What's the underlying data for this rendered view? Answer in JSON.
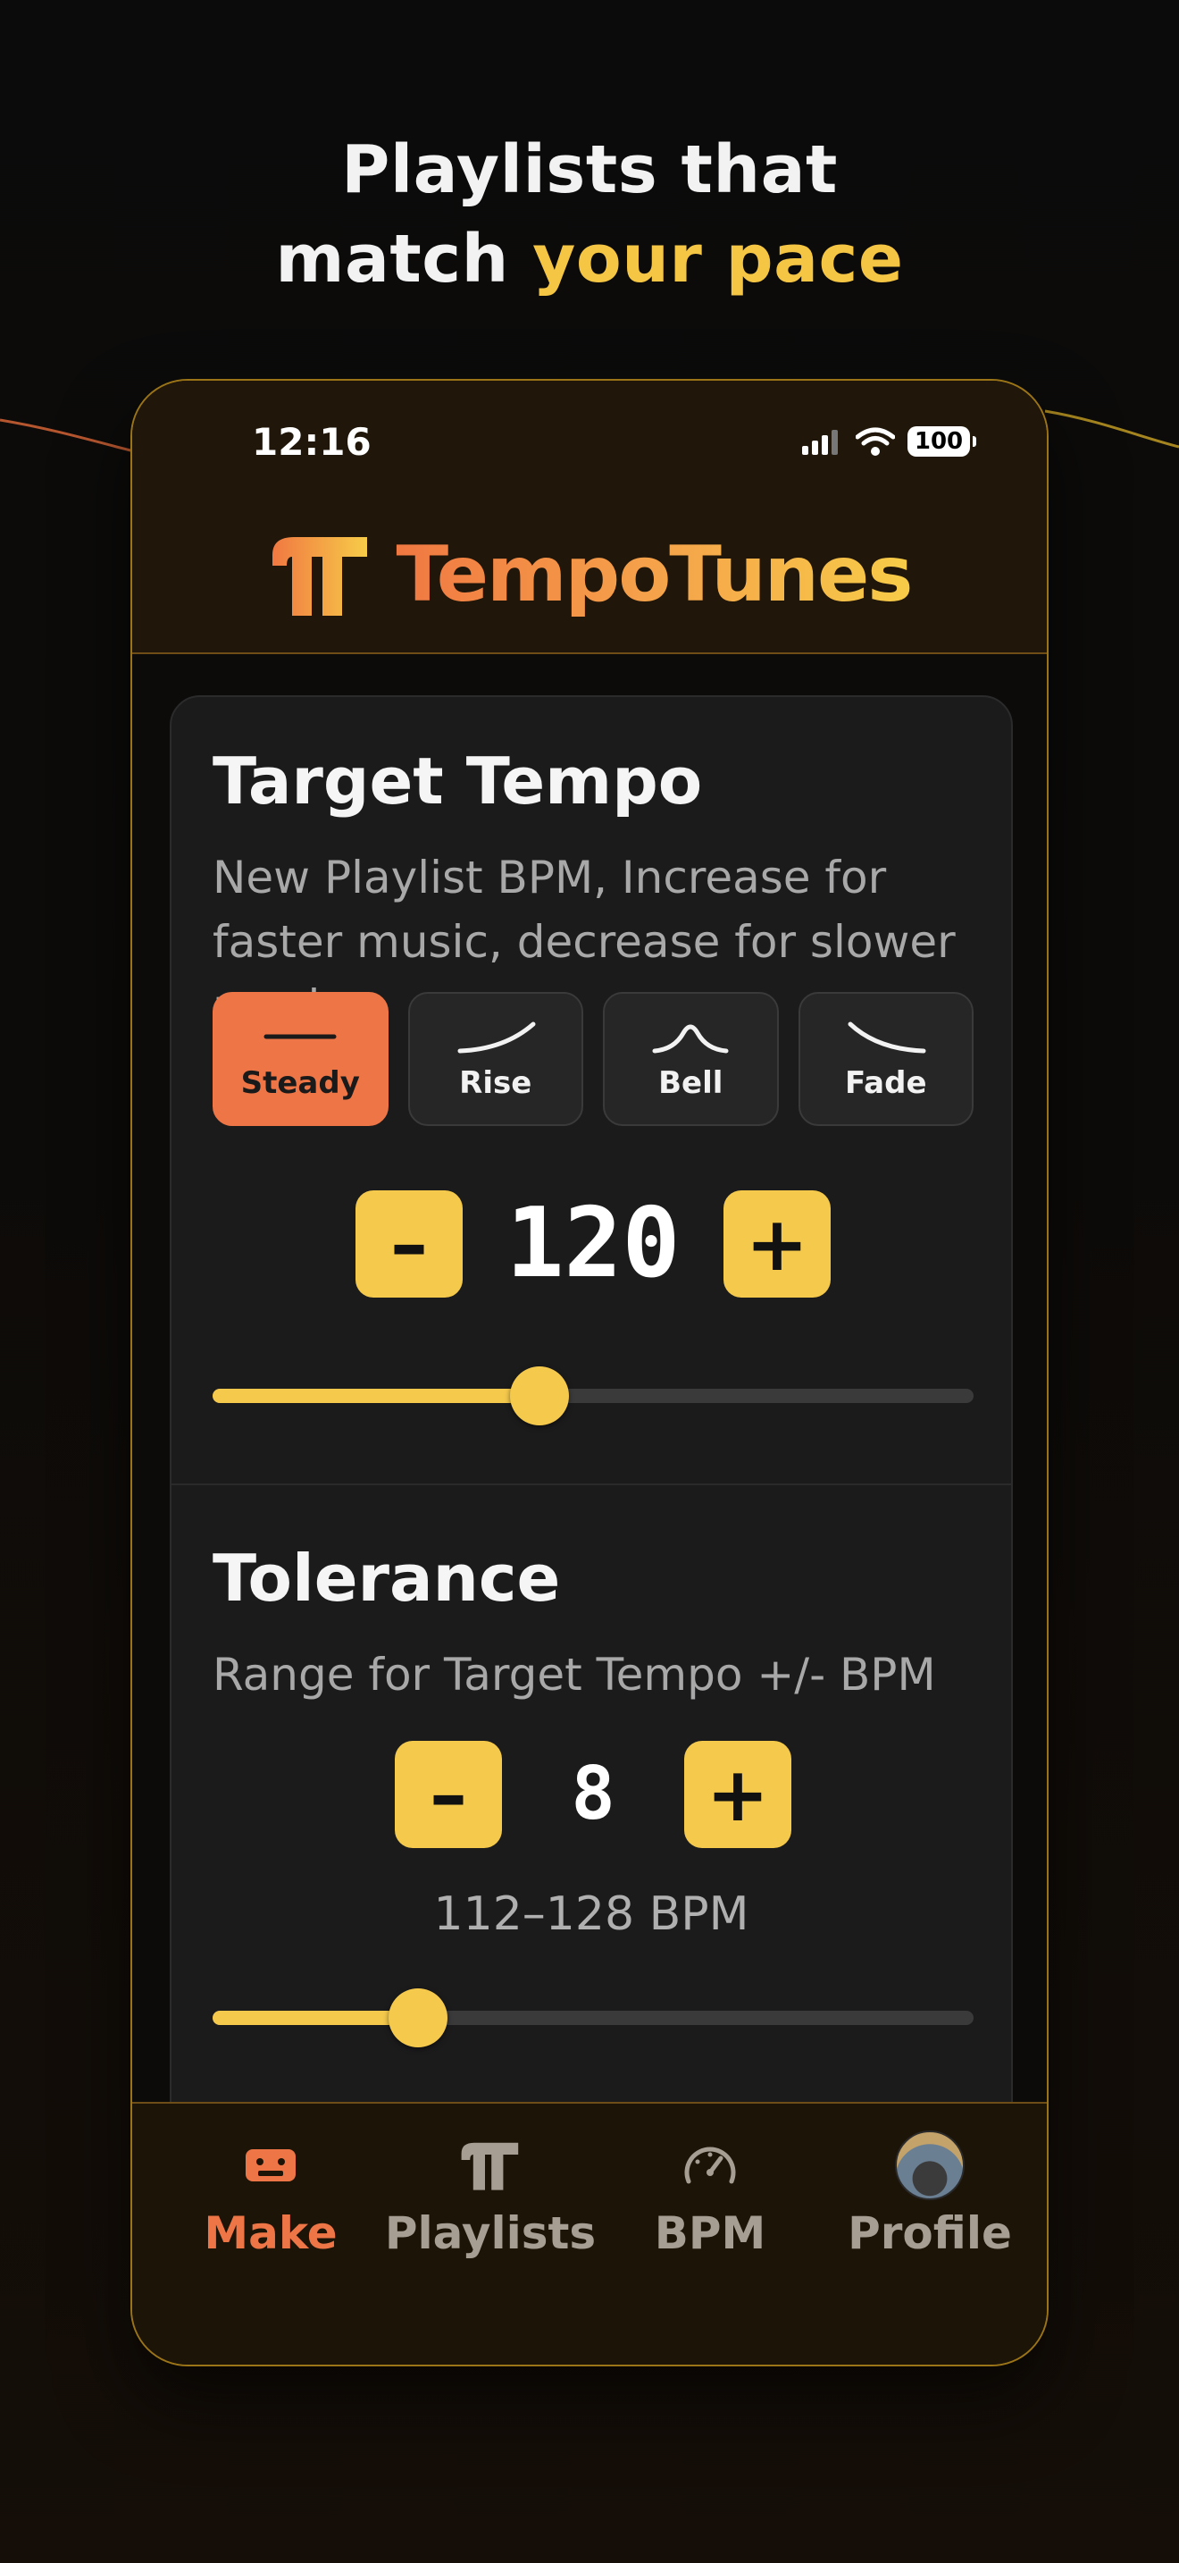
{
  "headline": {
    "line1": "Playlists that",
    "line2_plain": "match ",
    "line2_accent": "your pace"
  },
  "status_bar": {
    "time": "12:16",
    "battery": "100",
    "icons": [
      "signal-icon",
      "wifi-icon",
      "battery-icon"
    ]
  },
  "brand": {
    "name": "TempoTunes",
    "logo_icon": "tt-logo-icon"
  },
  "target_tempo": {
    "title": "Target Tempo",
    "description": "New Playlist BPM, Increase for faster music, decrease for slower music",
    "curves": [
      {
        "label": "Steady",
        "icon": "flat-line-icon",
        "active": true
      },
      {
        "label": "Rise",
        "icon": "rise-curve-icon",
        "active": false
      },
      {
        "label": "Bell",
        "icon": "bell-curve-icon",
        "active": false
      },
      {
        "label": "Fade",
        "icon": "fade-curve-icon",
        "active": false
      }
    ],
    "decrement_label": "–",
    "increment_label": "+",
    "value": "120",
    "slider_fraction": 0.43
  },
  "tolerance": {
    "title": "Tolerance",
    "description": "Range for Target Tempo +/- BPM",
    "decrement_label": "–",
    "increment_label": "+",
    "value": "8",
    "range_text": "112–128 BPM",
    "slider_fraction": 0.27
  },
  "tabbar": {
    "items": [
      {
        "label": "Make",
        "icon": "cassette-icon",
        "active": true
      },
      {
        "label": "Playlists",
        "icon": "tt-logo-icon",
        "active": false
      },
      {
        "label": "BPM",
        "icon": "gauge-icon",
        "active": false
      },
      {
        "label": "Profile",
        "icon": "avatar-icon",
        "active": false
      }
    ]
  },
  "colors": {
    "accent_yellow": "#f5c94c",
    "accent_orange": "#ee7646",
    "inactive_tab": "#a69e92"
  }
}
